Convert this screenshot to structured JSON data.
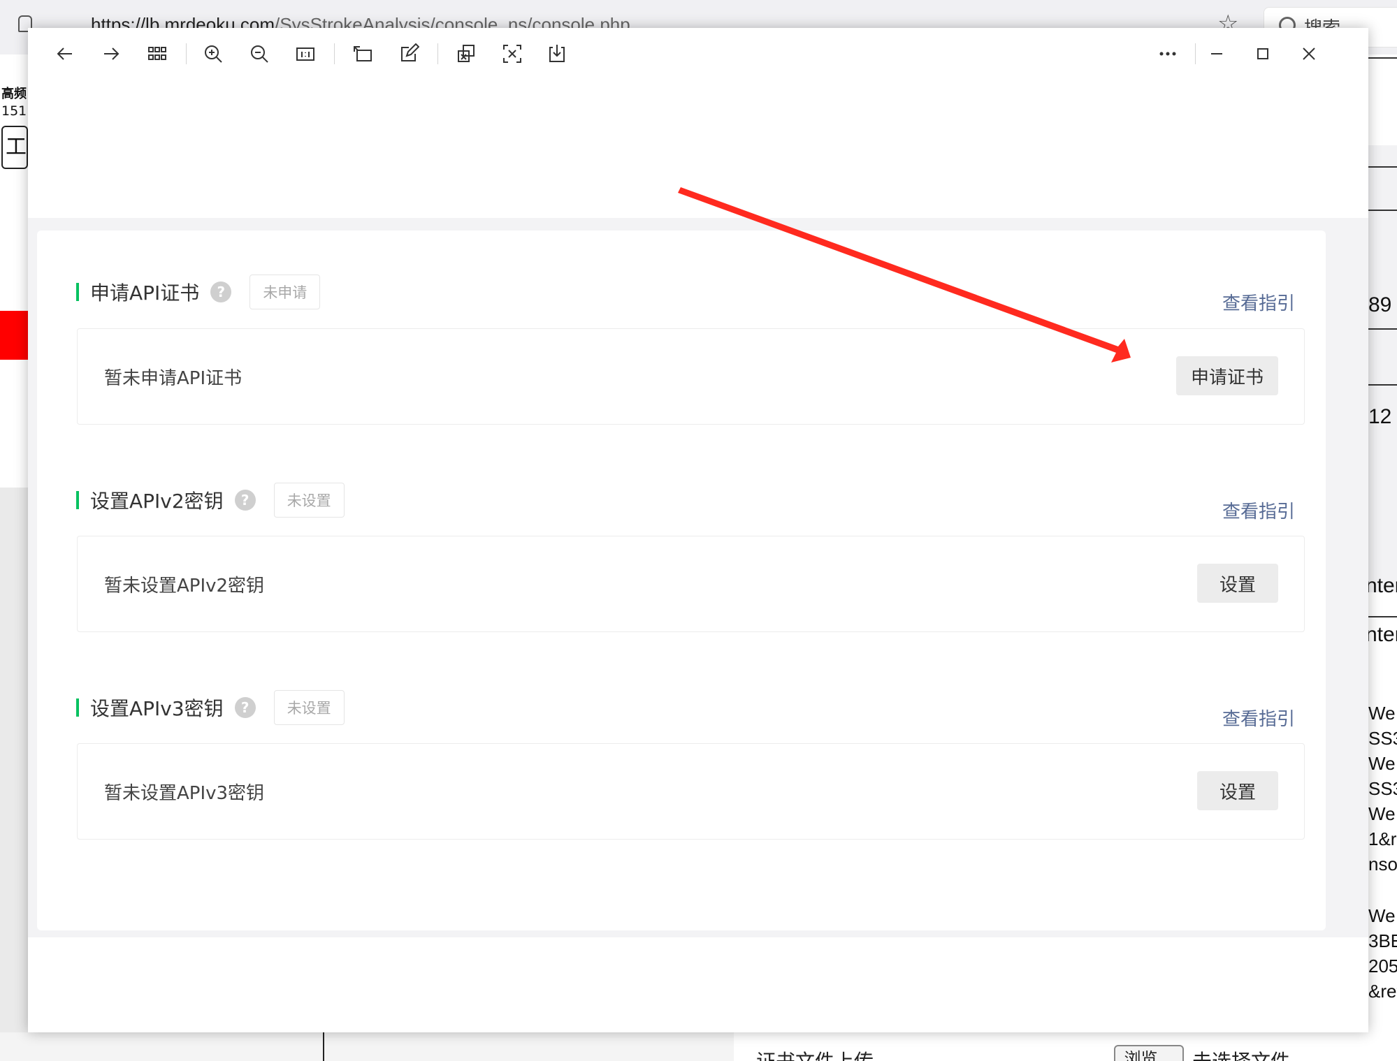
{
  "background_browser": {
    "url_host": "https://lb.mrdeoku.com",
    "url_path": "/SysStrokeAnalysis/console_ns/console.php",
    "search_placeholder": "搜索",
    "left_text_1": "高频",
    "left_text_2": "151",
    "left_button": "工",
    "right_fragments": [
      "89",
      "12",
      "nter",
      "nter",
      "We",
      "SS3",
      "We",
      "SS3",
      "We",
      "1&r",
      "nsol",
      "We",
      "3BE",
      "205",
      "&ret"
    ],
    "bottom_label": "证书文件上传",
    "bottom_browse": "浏览...",
    "bottom_nofile": "未选择文件。"
  },
  "viewer": {
    "toolbar": {
      "buttons": [
        "back",
        "forward",
        "gallery",
        "zoom-in",
        "zoom-out",
        "actual-size",
        "rotate",
        "edit",
        "copy",
        "extract-text",
        "save",
        "more",
        "minimize",
        "maximize",
        "close"
      ]
    },
    "sections": [
      {
        "title": "申请API证书",
        "help": "?",
        "status": "未申请",
        "guide": "查看指引",
        "box_text": "暂未申请API证书",
        "button": "申请证书"
      },
      {
        "title": "设置APIv2密钥",
        "help": "?",
        "status": "未设置",
        "guide": "查看指引",
        "box_text": "暂未设置APIv2密钥",
        "button": "设置"
      },
      {
        "title": "设置APIv3密钥",
        "help": "?",
        "status": "未设置",
        "guide": "查看指引",
        "box_text": "暂未设置APIv3密钥",
        "button": "设置"
      }
    ]
  },
  "colors": {
    "accent_green": "#07c160",
    "link_blue": "#576b95",
    "arrow_red": "#ff2a1f"
  }
}
